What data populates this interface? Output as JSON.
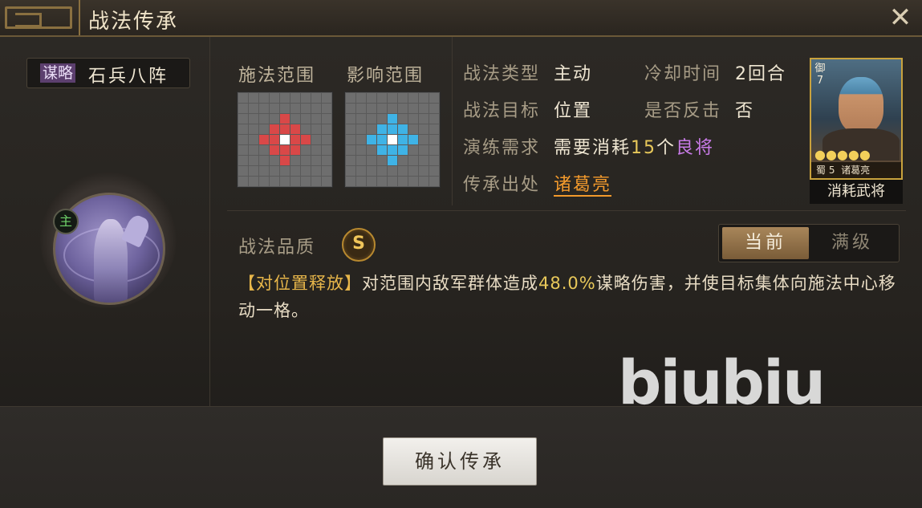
{
  "header": {
    "title": "战法传承",
    "close_icon": "close-icon"
  },
  "skill": {
    "type_tag": "谋略",
    "name": "石兵八阵",
    "badge": "主"
  },
  "ranges": {
    "cast_label": "施法范围",
    "effect_label": "影响范围"
  },
  "attributes": {
    "type_label": "战法类型",
    "type_value": "主动",
    "cooldown_label": "冷却时间",
    "cooldown_value": "2回合",
    "target_label": "战法目标",
    "target_value": "位置",
    "counter_label": "是否反击",
    "counter_value": "否",
    "training_label": "演练需求",
    "training_prefix": "需要消耗",
    "training_count": "15",
    "training_unit": "个",
    "training_item": "良将",
    "origin_label": "传承出处",
    "origin_value": "诸葛亮"
  },
  "card": {
    "rank": "御7",
    "stars": "●●●●●",
    "faction": "蜀",
    "cost": "5",
    "name": "诸葛亮",
    "caption": "消耗武将"
  },
  "quality": {
    "label": "战法品质",
    "grade": "S"
  },
  "level_toggle": {
    "current": "当前",
    "max": "满级"
  },
  "description": {
    "tag": "【对位置释放】",
    "part1": "对范围内敌军群体造成",
    "percent": "48.0%",
    "part2": "谋略伤害，并使目标集体向施法中心移动一格。"
  },
  "confirm_button": "确认传承",
  "watermark": "biubiu",
  "colors": {
    "accent": "#e8c85a",
    "cast_range": "#d94848",
    "effect_range": "#3fb3e6",
    "link": "#f39a2c"
  }
}
